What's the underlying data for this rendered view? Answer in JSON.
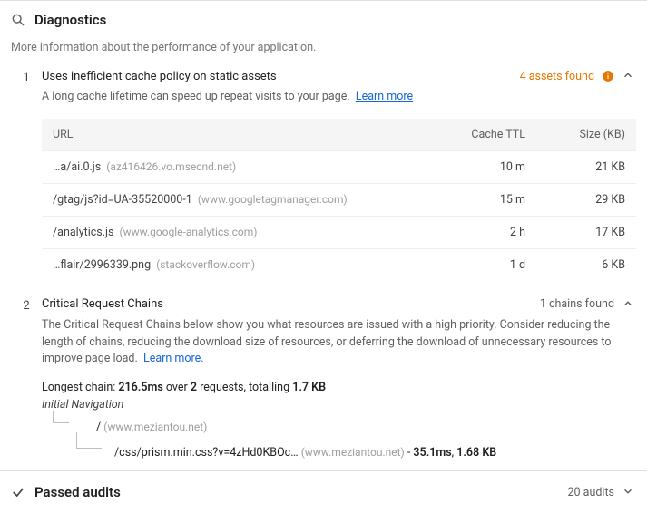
{
  "diagnostics": {
    "title": "Diagnostics",
    "description": "More information about the performance of your application."
  },
  "audits": [
    {
      "index": "1",
      "title": "Uses inefficient cache policy on static assets",
      "summary": "4 assets found",
      "summary_style": "orange",
      "has_info_icon": true,
      "description": "A long cache lifetime can speed up repeat visits to your page.",
      "learn_more": "Learn more",
      "table_headers": {
        "url": "URL",
        "ttl": "Cache TTL",
        "size": "Size (KB)"
      },
      "rows": [
        {
          "path": "…a/ai.0.js",
          "host": "(az416426.vo.msecnd.net)",
          "ttl": "10 m",
          "size": "21 KB"
        },
        {
          "path": "/gtag/js?id=UA-35520000-1",
          "host": "(www.googletagmanager.com)",
          "ttl": "15 m",
          "size": "29 KB"
        },
        {
          "path": "/analytics.js",
          "host": "(www.google-analytics.com)",
          "ttl": "2 h",
          "size": "17 KB"
        },
        {
          "path": "…flair/2996339.png",
          "host": "(stackoverflow.com)",
          "ttl": "1 d",
          "size": "6 KB"
        }
      ]
    },
    {
      "index": "2",
      "title": "Critical Request Chains",
      "summary": "1 chains found",
      "summary_style": "gray",
      "has_info_icon": false,
      "description": "The Critical Request Chains below show you what resources are issued with a high priority. Consider reducing the length of chains, reducing the download size of resources, or deferring the download of unnecessary resources to improve page load.",
      "learn_more": "Learn more.",
      "chain": {
        "longest_prefix": "Longest chain:",
        "longest_time": "216.5ms",
        "over": "over",
        "req_count": "2",
        "req_suffix": "requests, totalling",
        "total_size": "1.7 KB",
        "root_label": "Initial Navigation",
        "nodes": [
          {
            "depth": 0,
            "path": "/",
            "host": "(www.meziantou.net)",
            "stats": ""
          },
          {
            "depth": 1,
            "path": "/css/prism.min.css?v=4zHd0KBOc…",
            "host": "(www.meziantou.net)",
            "stats": " - 35.1ms, 1.68 KB",
            "stats_bold_a": "35.1ms",
            "stats_bold_b": "1.68 KB"
          }
        ]
      }
    }
  ],
  "passed": {
    "title": "Passed audits",
    "count": "20 audits"
  }
}
